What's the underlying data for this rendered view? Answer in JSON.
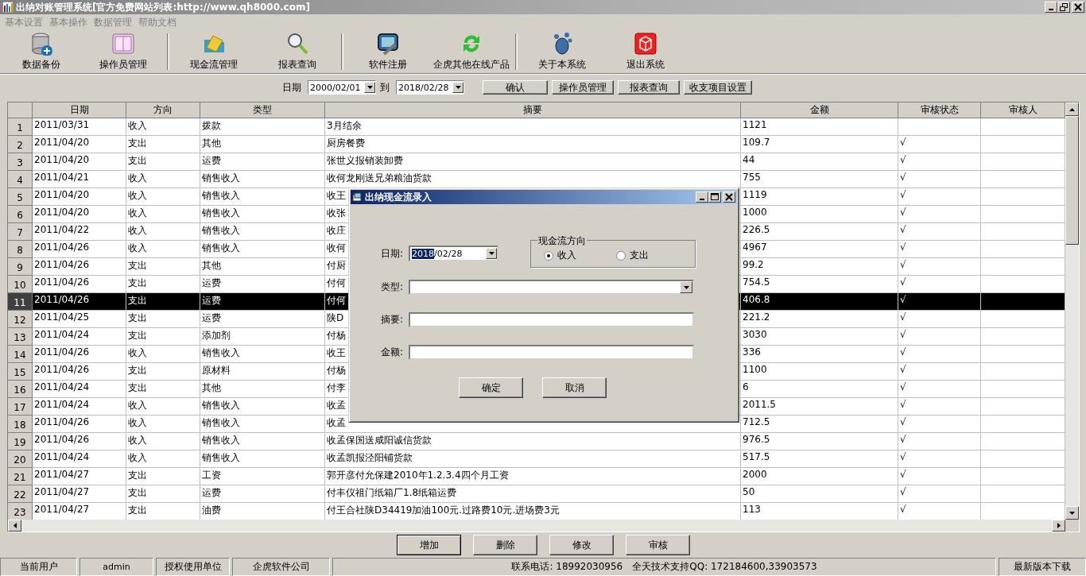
{
  "window": {
    "title": "出纳对账管理系统[官方免费网站列表:http://www.qh8000.com]"
  },
  "menu": [
    "基本设置",
    "基本操作",
    "数据管理",
    "帮助文档"
  ],
  "toolbar": [
    {
      "label": "数据备份",
      "separator_before": false
    },
    {
      "label": "操作员管理",
      "separator_before": false
    },
    {
      "label": "现金流管理",
      "separator_before": true
    },
    {
      "label": "报表查询",
      "separator_before": false
    },
    {
      "label": "软件注册",
      "separator_before": true
    },
    {
      "label": "企虎其他在线产品",
      "separator_before": false
    },
    {
      "label": "关于本系统",
      "separator_before": true
    },
    {
      "label": "退出系统",
      "separator_before": false
    }
  ],
  "filter": {
    "date_label": "日期",
    "from": "2000/02/01",
    "to_label": "到",
    "to": "2018/02/28",
    "buttons": [
      "确认",
      "操作员管理",
      "报表查询",
      "收支项目设置"
    ]
  },
  "table": {
    "columns": [
      "日期",
      "方向",
      "类型",
      "摘要",
      "金额",
      "审核状态",
      "审核人"
    ],
    "rows": [
      {
        "no": "1",
        "cells": [
          "2011/03/31",
          "收入",
          "拨款",
          "3月结余",
          "1121",
          "",
          ""
        ],
        "selected": false
      },
      {
        "no": "2",
        "cells": [
          "2011/04/20",
          "支出",
          "其他",
          "厨房餐费",
          "109.7",
          "√",
          ""
        ],
        "selected": false
      },
      {
        "no": "3",
        "cells": [
          "2011/04/20",
          "支出",
          "运费",
          "张世义报销装卸费",
          "44",
          "√",
          ""
        ],
        "selected": false
      },
      {
        "no": "4",
        "cells": [
          "2011/04/21",
          "收入",
          "销售收入",
          "收何龙刚送兄弟粮油货款",
          "755",
          "√",
          ""
        ],
        "selected": false
      },
      {
        "no": "5",
        "cells": [
          "2011/04/20",
          "收入",
          "销售收入",
          "收王",
          "1119",
          "√",
          ""
        ],
        "selected": false
      },
      {
        "no": "6",
        "cells": [
          "2011/04/20",
          "收入",
          "销售收入",
          "收张",
          "1000",
          "√",
          ""
        ],
        "selected": false
      },
      {
        "no": "7",
        "cells": [
          "2011/04/22",
          "收入",
          "销售收入",
          "收庄",
          "226.5",
          "√",
          ""
        ],
        "selected": false
      },
      {
        "no": "8",
        "cells": [
          "2011/04/26",
          "收入",
          "销售收入",
          "收何",
          "4967",
          "√",
          ""
        ],
        "selected": false
      },
      {
        "no": "9",
        "cells": [
          "2011/04/26",
          "支出",
          "其他",
          "付厨",
          "99.2",
          "√",
          ""
        ],
        "selected": false
      },
      {
        "no": "10",
        "cells": [
          "2011/04/26",
          "支出",
          "运费",
          "付何",
          "754.5",
          "√",
          ""
        ],
        "selected": false
      },
      {
        "no": "11",
        "cells": [
          "2011/04/26",
          "支出",
          "运费",
          "付何",
          "406.8",
          "√",
          ""
        ],
        "selected": true
      },
      {
        "no": "12",
        "cells": [
          "2011/04/25",
          "支出",
          "运费",
          "陕D",
          "221.2",
          "√",
          ""
        ],
        "selected": false
      },
      {
        "no": "13",
        "cells": [
          "2011/04/24",
          "支出",
          "添加剂",
          "付杨",
          "3030",
          "√",
          ""
        ],
        "selected": false
      },
      {
        "no": "14",
        "cells": [
          "2011/04/26",
          "收入",
          "销售收入",
          "收王",
          "336",
          "√",
          ""
        ],
        "selected": false
      },
      {
        "no": "15",
        "cells": [
          "2011/04/26",
          "支出",
          "原材料",
          "付杨",
          "1100",
          "√",
          ""
        ],
        "selected": false
      },
      {
        "no": "16",
        "cells": [
          "2011/04/24",
          "支出",
          "其他",
          "付李",
          "6",
          "√",
          ""
        ],
        "selected": false
      },
      {
        "no": "17",
        "cells": [
          "2011/04/24",
          "收入",
          "销售收入",
          "收孟",
          "2011.5",
          "√",
          ""
        ],
        "selected": false
      },
      {
        "no": "18",
        "cells": [
          "2011/04/26",
          "收入",
          "销售收入",
          "收孟",
          "712.5",
          "√",
          ""
        ],
        "selected": false
      },
      {
        "no": "19",
        "cells": [
          "2011/04/26",
          "收入",
          "销售收入",
          "收孟保国送咸阳诚信货款",
          "976.5",
          "√",
          ""
        ],
        "selected": false
      },
      {
        "no": "20",
        "cells": [
          "2011/04/24",
          "收入",
          "销售收入",
          "收孟凯报泾阳铺货款",
          "517.5",
          "√",
          ""
        ],
        "selected": false
      },
      {
        "no": "21",
        "cells": [
          "2011/04/27",
          "支出",
          "工资",
          "郭开彦付允保建2010年1.2.3.4四个月工资",
          "2000",
          "√",
          ""
        ],
        "selected": false
      },
      {
        "no": "22",
        "cells": [
          "2011/04/27",
          "支出",
          "运费",
          "付丰仪祖门纸箱厂1.8纸箱运费",
          "50",
          "√",
          ""
        ],
        "selected": false
      },
      {
        "no": "23",
        "cells": [
          "2011/04/27",
          "支出",
          "油费",
          "付王合社陕D34419加油100元.过路费10元.进场费3元",
          "113",
          "√",
          ""
        ],
        "selected": false
      }
    ]
  },
  "actions": [
    {
      "label": "增加",
      "default": true
    },
    {
      "label": "删除",
      "default": false
    },
    {
      "label": "修改",
      "default": false
    },
    {
      "label": "审核",
      "default": false
    }
  ],
  "status_bar": [
    {
      "texts": [
        "当前用户"
      ]
    },
    {
      "texts": [
        "admin"
      ]
    },
    {
      "texts": [
        "授权使用单位"
      ]
    },
    {
      "texts": [
        "企虎软件公司"
      ]
    },
    {
      "texts": [
        "联系电话: 18992030956",
        "全天技术支持QQ: 172184600,33903573"
      ]
    },
    {
      "texts": [
        "最新版本下载"
      ]
    }
  ],
  "dialog": {
    "title": "出纳现金流录入",
    "date": {
      "label": "日期:",
      "selected_part": "2018",
      "rest": "/02/28"
    },
    "direction": {
      "legend": "现金流方向",
      "options": [
        {
          "label": "收入",
          "selected": true
        },
        {
          "label": "支出",
          "selected": false
        }
      ]
    },
    "fields": [
      {
        "label": "类型:",
        "kind": "dropdown"
      },
      {
        "label": "摘要:",
        "kind": "text"
      },
      {
        "label": "金额:",
        "kind": "text"
      }
    ],
    "buttons": [
      "确定",
      "取消"
    ]
  }
}
